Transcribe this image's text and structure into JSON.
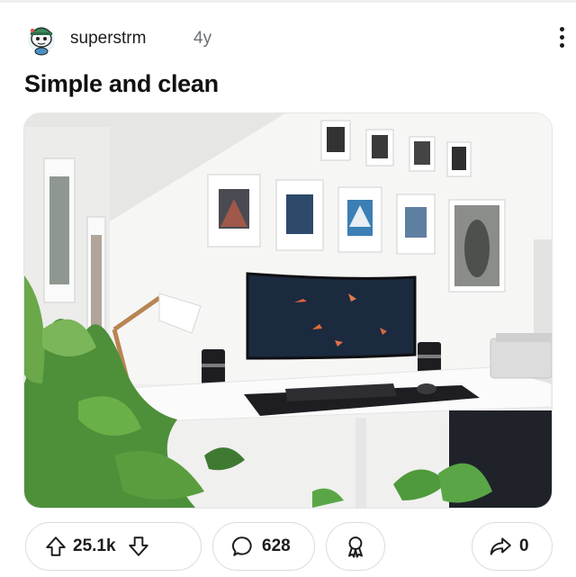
{
  "post": {
    "username": "superstrm",
    "age": "4y",
    "title": "Simple and clean",
    "image_alt": "Minimal white desk setup with curved monitor, lamp, speakers and framed art"
  },
  "actions": {
    "upvotes": "25.1k",
    "comments": "628",
    "shares": "0"
  },
  "icons": {
    "avatar": "reddit-snoo-avatar-icon",
    "more": "more-vertical-icon",
    "upvote": "upvote-arrow-icon",
    "downvote": "downvote-arrow-icon",
    "comment": "comment-bubble-icon",
    "award": "award-icon",
    "share": "share-arrow-icon"
  },
  "colors": {
    "text": "#1a1a1b",
    "muted": "#6b6f73",
    "border": "#dadce0"
  }
}
